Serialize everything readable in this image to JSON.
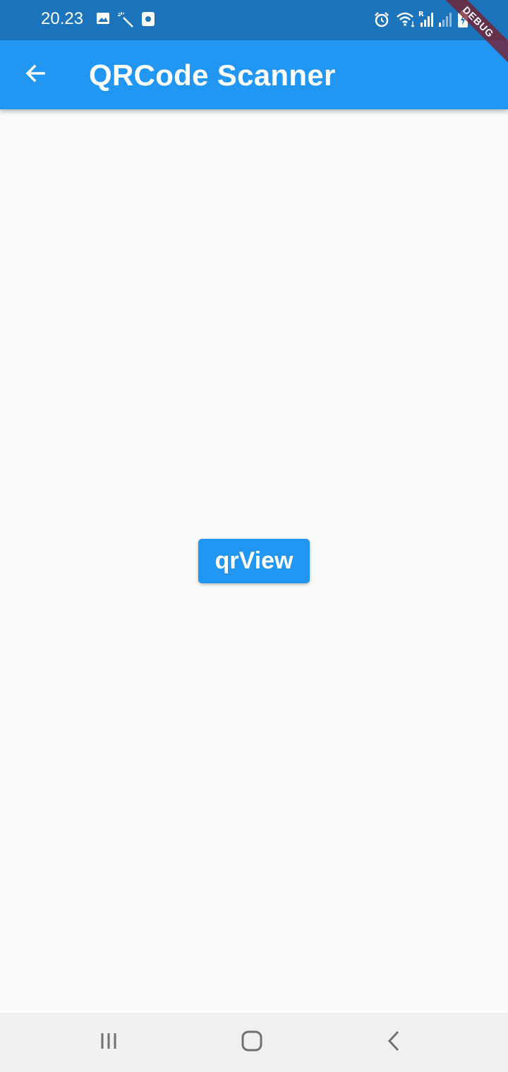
{
  "status_bar": {
    "time": "20.23",
    "left_icons": [
      "image-icon",
      "magic-wand-icon",
      "screen-record-icon"
    ],
    "right_icons": [
      "alarm-icon",
      "wifi-icon",
      "signal-roaming-icon",
      "signal-icon",
      "battery-charging-icon"
    ]
  },
  "debug_banner": {
    "label": "DEBUG"
  },
  "app_bar": {
    "title": "QRCode Scanner",
    "back_icon": "arrow-back-icon",
    "color": "#2196f3"
  },
  "main": {
    "button_label": "qrView"
  },
  "nav_bar": {
    "buttons": [
      "recent-apps-icon",
      "home-icon",
      "back-chevron-icon"
    ]
  },
  "colors": {
    "status_bar": "#1c75bc",
    "app_bar": "#2196f3",
    "background": "#fafafa",
    "nav_bar": "#f0f0f0"
  }
}
